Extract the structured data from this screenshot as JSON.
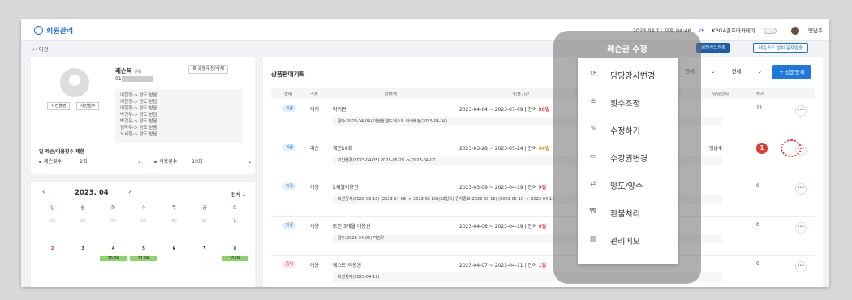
{
  "header": {
    "title": "회원관리",
    "datetime": "2023.04.11 오후 04:46",
    "academy": "KPGA골프아카데미",
    "user": "맹남주"
  },
  "subbar": {
    "back": "이전",
    "card_register": "회원카드등록",
    "guide": "레슨카드 설치 문자발송"
  },
  "profile": {
    "photo_take": "사진촬영",
    "photo_attach": "사진첨부",
    "name": "레슨북",
    "name_tag": "(여)",
    "phone_prefix": "01",
    "edit": "회원수정/삭제",
    "memo": [
      "이현정-> 양도 받음",
      "이현정-> 양도 받음",
      "이현정-> 양도 받음",
      "박건우-> 양도 받음",
      "박건우-> 양도 받음",
      "김득주-> 양도 받음",
      "노서현-> 양도 받음"
    ],
    "usage_title": "일 레슨/이용횟수 제한",
    "lesson_label": "레슨횟수",
    "lesson_value": "2회",
    "use_label": "이용횟수",
    "use_value": "10회"
  },
  "calendar": {
    "month": "2023. 04",
    "filter": "전체",
    "weekdays": [
      "일",
      "월",
      "화",
      "수",
      "목",
      "금",
      "토"
    ],
    "week1": [
      "26",
      "27",
      "28",
      "29",
      "30",
      "31",
      "1"
    ],
    "week2": [
      "2",
      "3",
      "4",
      "5",
      "6",
      "7",
      "8"
    ],
    "ev1": "20:00",
    "ev2": "11:00",
    "ev3": "10:00"
  },
  "sales": {
    "title": "상품판매기록",
    "filter1": "전체",
    "filter2": "전체",
    "add": "+ 상품등록",
    "columns": [
      "상태",
      "구분",
      "상품명",
      "이용기간",
      "담당강사",
      "락커"
    ],
    "rows": [
      {
        "status": "이용",
        "type": "락커",
        "name": "락커권",
        "period": "2023-04-04 ~ 2023-07-09",
        "remain_label": "잔여",
        "remain": "90일",
        "coach": "",
        "locker": "11",
        "note": "양수(2023-04-04) 이현정 양도테스트 락커배정(2023-04-04)"
      },
      {
        "status": "이용",
        "type": "레슨",
        "name": "개인10회",
        "period": "2023-03-28 ~ 2023-05-24",
        "remain_label": "잔여",
        "remain": "44일",
        "coach": "맹남주",
        "locker": "0",
        "note": "기간변경(2023-04-05) 2023-05-23 -> 2023-04-07"
      },
      {
        "status": "이용",
        "type": "이용",
        "name": "1개월이용권",
        "period": "2023-03-09 ~ 2023-04-19",
        "remain_label": "잔여",
        "remain": "9일",
        "coach": "",
        "locker": "0",
        "note": "회원중지(2023-03-10) (2023-04-08 -> 2023-05-10)(32일치) 중지종료(2023-03-16) (2023-05-10 -> 2023-04-14"
      },
      {
        "status": "이용",
        "type": "이용",
        "name": "오전 3개월 이용권",
        "period": "2023-04-06 ~ 2023-04-19",
        "remain_label": "잔여",
        "remain": "9일",
        "coach": "",
        "locker": "0",
        "note": "양수(2023-04-06) 박건우"
      },
      {
        "status": "중지",
        "type": "이용",
        "name": "테스트 이용권",
        "period": "2023-04-07 ~ 2023-04-11",
        "remain_label": "잔여",
        "remain": "1일",
        "coach": "",
        "locker": "0",
        "note": "회원중지(2023-04-11)"
      }
    ]
  },
  "popup": {
    "title": "레슨권 수정",
    "items": [
      {
        "label": "담당강사변경",
        "icon": "refresh-icon"
      },
      {
        "label": "횟수조정",
        "icon": "plus-minus-icon"
      },
      {
        "label": "수정하기",
        "icon": "pencil-icon"
      },
      {
        "label": "수강권변경",
        "icon": "card-icon"
      },
      {
        "label": "양도/양수",
        "icon": "transfer-icon"
      },
      {
        "label": "환불처리",
        "icon": "won-icon"
      },
      {
        "label": "관리메모",
        "icon": "memo-icon"
      }
    ]
  },
  "marker": "1",
  "colors": {
    "accent": "#1f6fd8",
    "marker": "#e53935",
    "event": "#8bd36b"
  }
}
